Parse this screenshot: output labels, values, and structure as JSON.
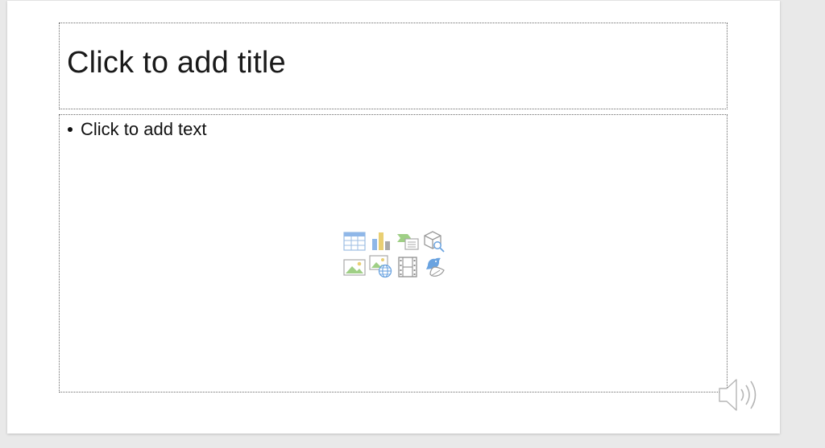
{
  "slide": {
    "title_placeholder": "Click to add title",
    "body_placeholder": "Click to add text"
  },
  "insert_icons": [
    {
      "name": "insert-table-icon"
    },
    {
      "name": "insert-chart-icon"
    },
    {
      "name": "insert-smartart-icon"
    },
    {
      "name": "insert-3d-model-icon"
    },
    {
      "name": "insert-picture-icon"
    },
    {
      "name": "insert-online-picture-icon"
    },
    {
      "name": "insert-video-icon"
    },
    {
      "name": "insert-icons-icon"
    }
  ],
  "audio": {
    "icon": "speaker-icon"
  },
  "colors": {
    "background": "#e9e9e9",
    "slide": "#ffffff",
    "placeholder_border": "#6b6b6b",
    "icon_blue": "#7fb0e6",
    "icon_green": "#b5d39a",
    "icon_gray": "#a9a9a9"
  }
}
